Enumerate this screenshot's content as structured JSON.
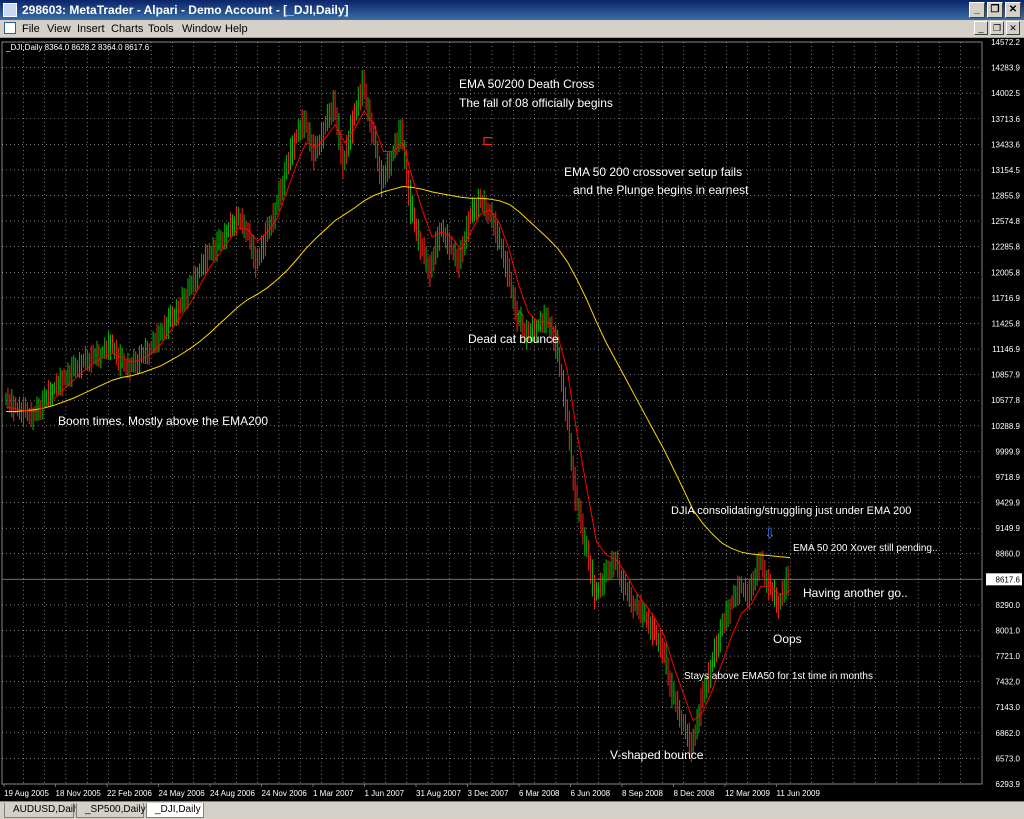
{
  "window": {
    "title": "298603: MetaTrader - Alpari - Demo Account - [_DJI,Daily]",
    "buttons": [
      "_",
      "❐",
      "✕"
    ]
  },
  "menu": {
    "items": [
      "File",
      "View",
      "Insert",
      "Charts",
      "Tools",
      "Window",
      "Help"
    ]
  },
  "chart": {
    "info_label": "_DJI,Daily  8364.0 8628.2 8364.0 8617.6",
    "current_price": "8617.6",
    "colors": {
      "background": "#000000",
      "grid": "#c0c0c0",
      "bull": "#00c000",
      "bear": "#ff2020",
      "ema50": "#ff0000",
      "ema200": "#ffd700",
      "annotation": "#ffffff"
    },
    "annotations": [
      "EMA 50/200 Death Cross",
      "The fall of 08 officially begins",
      "EMA 50 200 crossover setup fails",
      "and the Plunge begins in earnest",
      "Dead cat bounce",
      "Boom times. Mostly above the EMA200",
      "DJIA consolidating/struggling just under EMA 200",
      "EMA 50 200 Xover still pending..",
      "Having another go..",
      "Oops",
      "Stays above EMA50 for 1st time in months",
      "V-shaped bounce"
    ]
  },
  "tabs": [
    {
      "label": "AUDUSD,Daily",
      "active": false
    },
    {
      "label": "_SP500,Daily",
      "active": false
    },
    {
      "label": "_DJI,Daily",
      "active": true
    }
  ],
  "chart_data": {
    "type": "line",
    "title": "_DJI,Daily",
    "ylim": [
      6293.9,
      14572.2
    ],
    "ytick_labels": [
      "14572.2",
      "14283.9",
      "14002.5",
      "13713.6",
      "13433.6",
      "13154.5",
      "12855.9",
      "12574.8",
      "12285.8",
      "12005.8",
      "11716.9",
      "11425.8",
      "11146.9",
      "10857.9",
      "10577.8",
      "10288.9",
      "9999.9",
      "9718.9",
      "9429.9",
      "9149.9",
      "8860.0",
      "8617.6",
      "8290.0",
      "8001.0",
      "7721.0",
      "7432.0",
      "7143.0",
      "6862.0",
      "6573.0",
      "6293.9"
    ],
    "xtick_labels": [
      "19 Aug 2005",
      "18 Nov 2005",
      "22 Feb 2006",
      "24 May 2006",
      "24 Aug 2006",
      "24 Nov 2006",
      "1 Mar 2007",
      "1 Jun 2007",
      "31 Aug 2007",
      "3 Dec 2007",
      "6 Mar 2008",
      "6 Jun 2008",
      "8 Sep 2008",
      "8 Dec 2008",
      "12 Mar 2009",
      "11 Jun 2009"
    ],
    "series": [
      {
        "values": [
          10600,
          10500,
          10450,
          10400,
          10550,
          10700,
          10800,
          10900,
          11000,
          11050,
          11100,
          11200,
          11000,
          10950,
          11050,
          11150,
          11300,
          11450,
          11600,
          11800,
          12000,
          12200,
          12300,
          12450,
          12600,
          12500,
          12100,
          12400,
          12700,
          13100,
          13500,
          13700,
          13300,
          13600,
          13900,
          13200,
          13700,
          14100,
          13600,
          13000,
          13300,
          13600,
          12700,
          12300,
          12000,
          12500,
          12300,
          12100,
          12600,
          12800,
          12700,
          12400,
          12000,
          11500,
          11300,
          11400,
          11500,
          11200,
          10500,
          9500,
          9000,
          8400,
          8600,
          8800,
          8500,
          8300,
          8200,
          8000,
          7800,
          7300,
          7000,
          6700,
          7200,
          7600,
          8000,
          8300,
          8500,
          8400,
          8800,
          8500,
          8300,
          8617.6
        ]
      },
      {
        "values": [
          10500,
          10480,
          10460,
          10450,
          10500,
          10600,
          10700,
          10800,
          10900,
          10980,
          11050,
          11100,
          11050,
          11000,
          11030,
          11100,
          11200,
          11350,
          11500,
          11650,
          11850,
          12050,
          12200,
          12350,
          12500,
          12480,
          12350,
          12450,
          12600,
          12900,
          13200,
          13450,
          13400,
          13500,
          13650,
          13450,
          13600,
          13800,
          13650,
          13350,
          13350,
          13450,
          13050,
          12700,
          12400,
          12450,
          12400,
          12250,
          12450,
          12650,
          12700,
          12550,
          12250,
          11850,
          11550,
          11450,
          11450,
          11300,
          10900,
          10200,
          9600,
          9000,
          8850,
          8800,
          8650,
          8450,
          8300,
          8150,
          7950,
          7600,
          7300,
          7000,
          7100,
          7350,
          7650,
          7950,
          8200,
          8300,
          8500,
          8500,
          8400,
          8450
        ]
      },
      {
        "values": [
          10450,
          10450,
          10460,
          10470,
          10490,
          10520,
          10560,
          10600,
          10650,
          10700,
          10750,
          10800,
          10830,
          10850,
          10880,
          10920,
          10960,
          11020,
          11080,
          11150,
          11230,
          11320,
          11420,
          11520,
          11620,
          11700,
          11760,
          11830,
          11920,
          12020,
          12140,
          12270,
          12380,
          12480,
          12580,
          12650,
          12720,
          12800,
          12860,
          12900,
          12930,
          12960,
          12950,
          12930,
          12900,
          12880,
          12860,
          12840,
          12830,
          12830,
          12820,
          12800,
          12760,
          12680,
          12580,
          12480,
          12380,
          12270,
          12120,
          11920,
          11700,
          11450,
          11220,
          11020,
          10820,
          10620,
          10420,
          10220,
          10020,
          9800,
          9580,
          9350,
          9200,
          9080,
          8980,
          8920,
          8880,
          8860,
          8850,
          8840,
          8830,
          8820
        ]
      }
    ]
  }
}
